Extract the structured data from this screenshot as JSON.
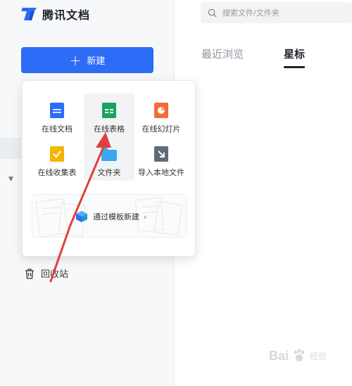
{
  "app": {
    "name": "腾讯文档"
  },
  "sidebar": {
    "new_button_label": "新建",
    "trash_label": "回收站"
  },
  "create_menu": {
    "items": [
      {
        "label": "在线文档",
        "icon": "online-doc-icon",
        "color": "#2c6cf6"
      },
      {
        "label": "在线表格",
        "icon": "online-sheet-icon",
        "color": "#1aa260"
      },
      {
        "label": "在线幻灯片",
        "icon": "online-slides-icon",
        "color": "#f26b3a"
      },
      {
        "label": "在线收集表",
        "icon": "online-form-icon",
        "color": "#f5b400"
      },
      {
        "label": "文件夹",
        "icon": "folder-icon",
        "color": "#39a8f0"
      },
      {
        "label": "导入本地文件",
        "icon": "import-file-icon",
        "color": "#5f6b7a"
      }
    ],
    "template_label": "通过模板新建"
  },
  "search": {
    "placeholder": "搜索文件/文件夹"
  },
  "tabs": [
    {
      "label": "最近浏览",
      "active": false
    },
    {
      "label": "星标",
      "active": true
    }
  ],
  "watermark": {
    "text": "Bai",
    "sub": "经验"
  },
  "colors": {
    "accent": "#2c6cf6",
    "annotation": "#e0403a"
  }
}
